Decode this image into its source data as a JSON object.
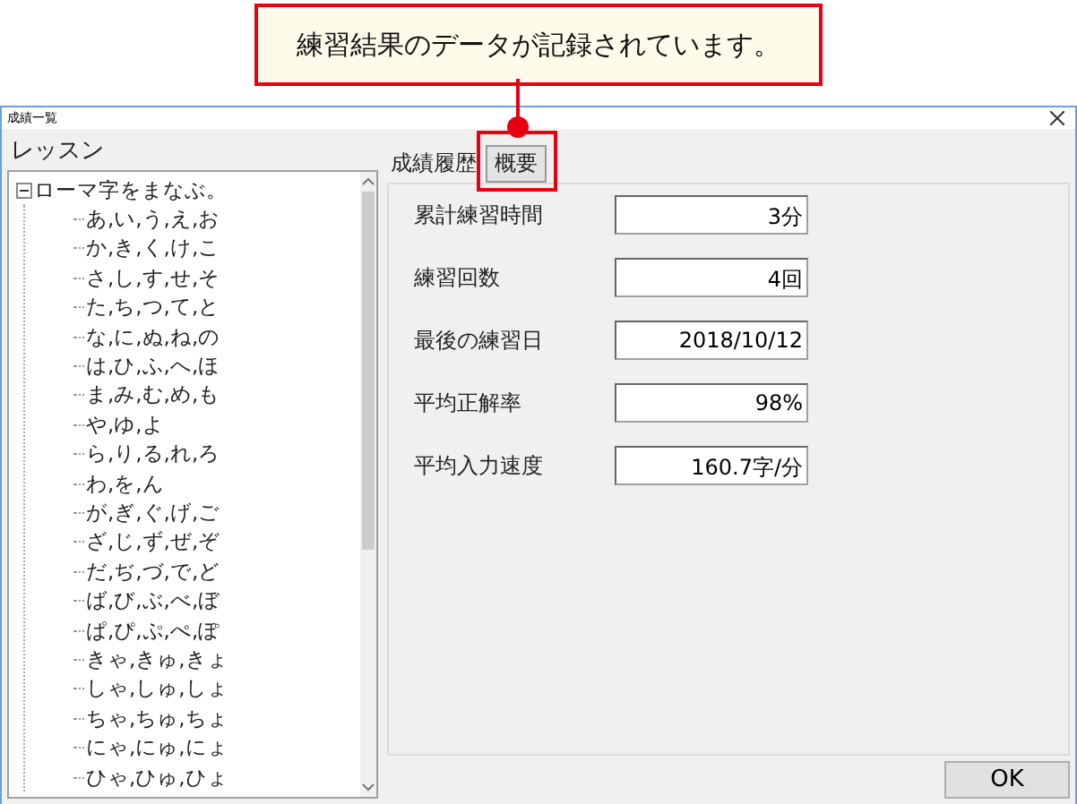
{
  "callout": {
    "text": "練習結果のデータが記録されています。"
  },
  "window": {
    "title": "成績一覧"
  },
  "lessons": {
    "label": "レッスン",
    "tree": [
      {
        "label": "ローマ字をまなぶ。",
        "expanded": true,
        "children": [
          {
            "label": "あ,い,う,え,お"
          },
          {
            "label": "か,き,く,け,こ"
          },
          {
            "label": "さ,し,す,せ,そ"
          },
          {
            "label": "た,ち,つ,て,と"
          },
          {
            "label": "な,に,ぬ,ね,の"
          },
          {
            "label": "は,ひ,ふ,へ,ほ"
          },
          {
            "label": "ま,み,む,め,も"
          },
          {
            "label": "や,ゆ,よ"
          },
          {
            "label": "ら,り,る,れ,ろ"
          },
          {
            "label": "わ,を,ん"
          },
          {
            "label": "が,ぎ,ぐ,げ,ご"
          },
          {
            "label": "ざ,じ,ず,ぜ,ぞ"
          },
          {
            "label": "だ,ぢ,づ,で,ど"
          },
          {
            "label": "ば,び,ぶ,べ,ぼ"
          },
          {
            "label": "ぱ,ぴ,ぷ,ぺ,ぽ"
          },
          {
            "label": "きゃ,きゅ,きょ"
          },
          {
            "label": "しゃ,しゅ,しょ"
          },
          {
            "label": "ちゃ,ちゅ,ちょ"
          },
          {
            "label": "にゃ,にゅ,にょ"
          },
          {
            "label": "ひゃ,ひゅ,ひょ"
          }
        ]
      }
    ]
  },
  "tabs": [
    {
      "label": "成績履歴",
      "selected": false,
      "highlighted": false
    },
    {
      "label": "概要",
      "selected": true,
      "highlighted": true
    }
  ],
  "fields": [
    {
      "label": "累計練習時間",
      "value": "3分"
    },
    {
      "label": "練習回数",
      "value": "4回"
    },
    {
      "label": "最後の練習日",
      "value": "2018/10/12"
    },
    {
      "label": "平均正解率",
      "value": "98%"
    },
    {
      "label": "平均入力速度",
      "value": "160.7字/分"
    }
  ],
  "buttons": [
    {
      "label": "OK"
    }
  ]
}
